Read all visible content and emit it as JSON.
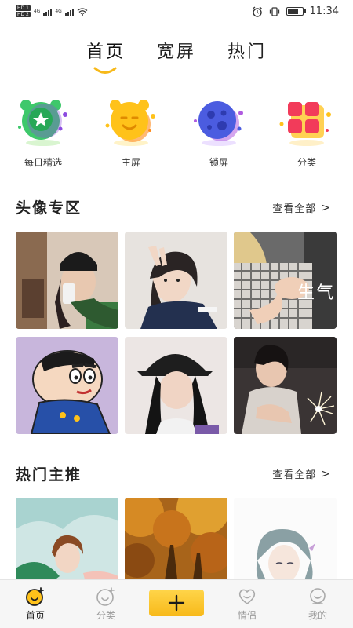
{
  "status_bar": {
    "hd1": "HD 1",
    "hd2": "HD 2",
    "net1": "4G",
    "net2": "4G",
    "time": "11:34",
    "battery_level": 0.75
  },
  "top_tabs": [
    {
      "label": "首页",
      "active": true
    },
    {
      "label": "宽屏",
      "active": false
    },
    {
      "label": "热门",
      "active": false
    }
  ],
  "categories": [
    {
      "label": "每日精选",
      "icon": "daily-picks-icon",
      "color": "#3ec86b"
    },
    {
      "label": "主屏",
      "icon": "home-screen-icon",
      "color": "#ffc21a"
    },
    {
      "label": "锁屏",
      "icon": "lock-screen-icon",
      "color": "#4b5ce0"
    },
    {
      "label": "分类",
      "icon": "category-icon",
      "color": "#f23b5a"
    }
  ],
  "avatar_section": {
    "title": "头像专区",
    "more": "查看全部",
    "tiles": [
      {
        "name": "avatar-girl-beanie"
      },
      {
        "name": "avatar-girl-peace-sign"
      },
      {
        "name": "avatar-baby-plaid",
        "caption": "生气"
      },
      {
        "name": "avatar-cartoon-boy"
      },
      {
        "name": "avatar-girl-cap"
      },
      {
        "name": "avatar-girl-sparkler"
      }
    ]
  },
  "hot_section": {
    "title": "热门主推",
    "more": "查看全部",
    "tiles": [
      {
        "name": "hot-illustration-girl"
      },
      {
        "name": "hot-autumn-forest"
      },
      {
        "name": "hot-sketch-girl"
      }
    ]
  },
  "bottom_nav": [
    {
      "label": "首页",
      "icon": "home-face-icon",
      "active": true
    },
    {
      "label": "分类",
      "icon": "category-face-icon",
      "active": false
    },
    {
      "label": "",
      "icon": "plus-icon",
      "active": false
    },
    {
      "label": "情侣",
      "icon": "couple-heart-icon",
      "active": false
    },
    {
      "label": "我的",
      "icon": "profile-face-icon",
      "active": false
    }
  ],
  "colors": {
    "accent": "#f7b91a",
    "nav_bg": "#f6f6f6"
  }
}
